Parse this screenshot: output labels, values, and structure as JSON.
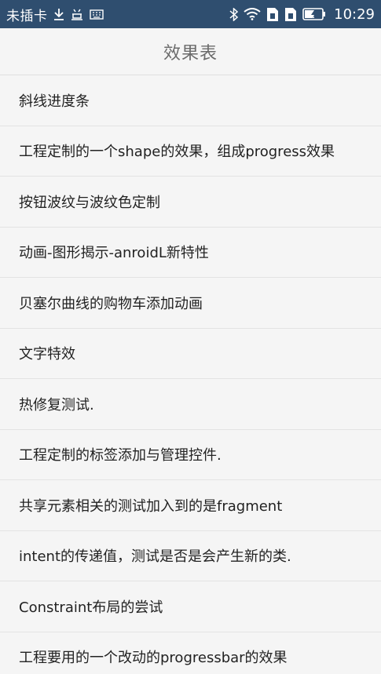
{
  "status_bar": {
    "carrier": "未插卡",
    "time": "10:29",
    "icons": [
      "download-icon",
      "usb-debug-icon",
      "keyboard-icon",
      "bluetooth-icon",
      "wifi-icon",
      "sim-icon",
      "sim-icon",
      "battery-charging-icon"
    ],
    "background": "#2f4e6f"
  },
  "app_bar": {
    "title": "效果表"
  },
  "list": {
    "items": [
      {
        "label": "斜线进度条"
      },
      {
        "label": "工程定制的一个shape的效果，组成progress效果"
      },
      {
        "label": "按钮波纹与波纹色定制"
      },
      {
        "label": "动画-图形揭示-anroidL新特性"
      },
      {
        "label": "贝塞尔曲线的购物车添加动画"
      },
      {
        "label": "文字特效"
      },
      {
        "label": "热修复测试."
      },
      {
        "label": "工程定制的标签添加与管理控件."
      },
      {
        "label": "共享元素相关的测试加入到的是fragment"
      },
      {
        "label": "intent的传递值，测试是否是会产生新的类."
      },
      {
        "label": "Constraint布局的尝试"
      },
      {
        "label": "工程要用的一个改动的progressbar的效果"
      }
    ]
  }
}
